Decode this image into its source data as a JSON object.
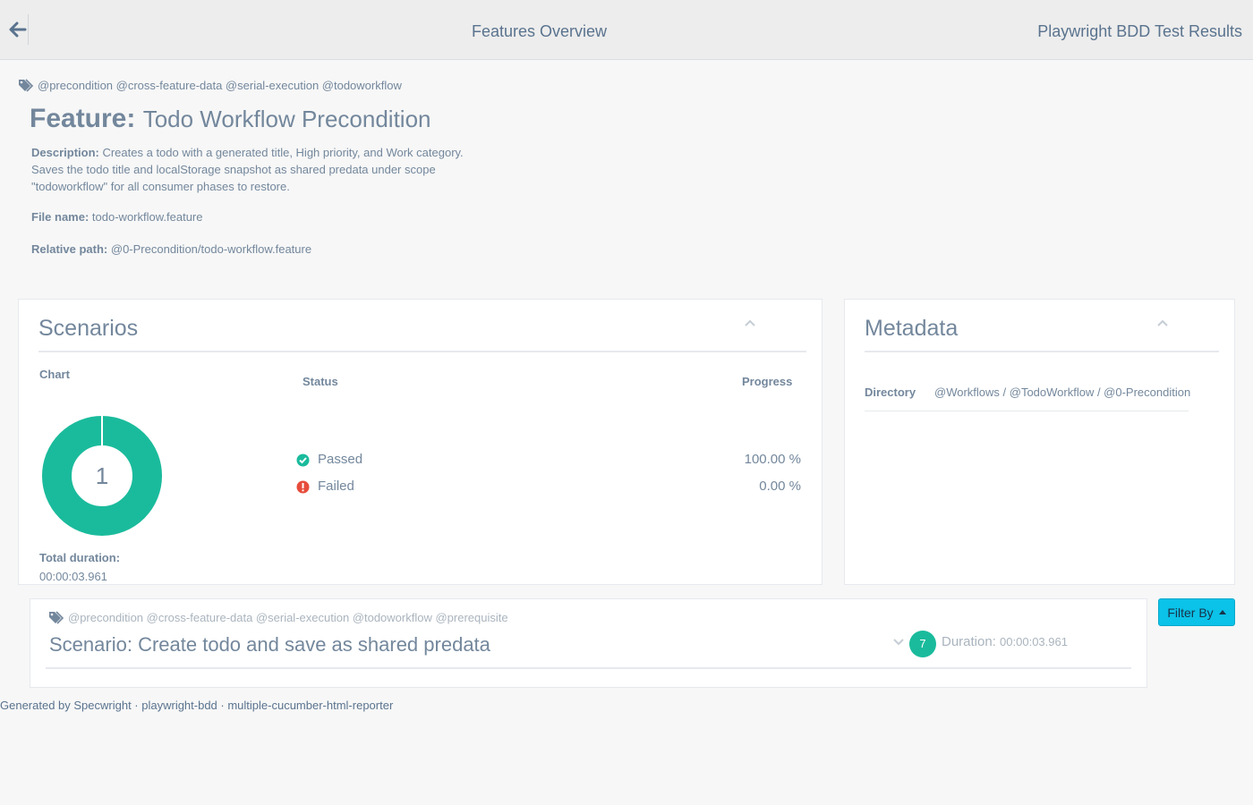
{
  "nav": {
    "title": "Features Overview",
    "brand": "Playwright BDD Test Results"
  },
  "feature": {
    "tags": "@precondition @cross-feature-data @serial-execution @todoworkflow",
    "keyword": "Feature:",
    "name": "Todo Workflow Precondition",
    "description_label": "Description:",
    "description": "Creates a todo with a generated title, High priority, and Work category. Saves the todo title and localStorage snapshot as shared predata under scope \"todoworkflow\" for all consumer phases to restore.",
    "file_name_label": "File name:",
    "file_name": "todo-workflow.feature",
    "relative_path_label": "Relative path:",
    "relative_path": "@0-Precondition/todo-workflow.feature"
  },
  "scenarios_panel": {
    "title": "Scenarios",
    "chart_label": "Chart",
    "status_header": "Status",
    "progress_header": "Progress",
    "total_duration_label": "Total duration:",
    "total_duration": "00:00:03.961",
    "rows": [
      {
        "label": "Passed",
        "progress": "100.00 %",
        "color": "#1ABB9C",
        "icon": "check-circle-icon"
      },
      {
        "label": "Failed",
        "progress": "0.00 %",
        "color": "#E74C3C",
        "icon": "exclamation-circle-icon"
      }
    ]
  },
  "chart_data": {
    "type": "pie",
    "center_label": "1",
    "slices": [
      {
        "name": "Passed",
        "value": 1,
        "color": "#1ABB9C"
      },
      {
        "name": "Failed",
        "value": 0,
        "color": "#E74C3C"
      }
    ]
  },
  "metadata_panel": {
    "title": "Metadata",
    "directory_label": "Directory",
    "directory": "@Workflows / @TodoWorkflow / @0-Precondition"
  },
  "scenario": {
    "tags": "@precondition @cross-feature-data @serial-execution @todoworkflow @prerequisite",
    "keyword": "Scenario:",
    "name": "Create todo and save as shared predata",
    "step_count": "7",
    "duration_label": "Duration:",
    "duration": "00:00:03.961"
  },
  "filter": {
    "label": "Filter By"
  },
  "footer": {
    "text": "Generated by Specwright · playwright-bdd · multiple-cucumber-html-reporter"
  },
  "colors": {
    "accent": "#1ABB9C",
    "failed": "#E74C3C",
    "filter_button": "#0bc2e8"
  }
}
